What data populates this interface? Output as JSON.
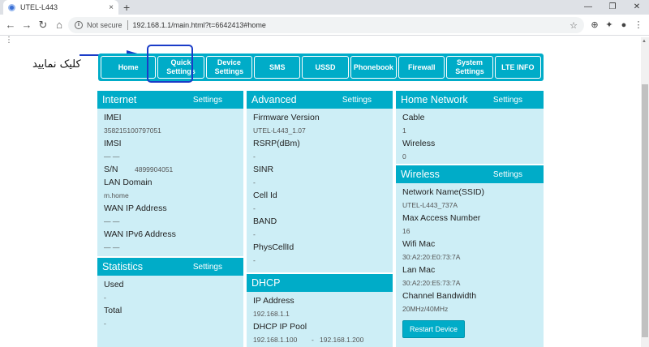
{
  "browser": {
    "tab_title": "UTEL-L443",
    "tab_close": "×",
    "new_tab": "+",
    "window_controls": [
      "—",
      "❐",
      "✕"
    ],
    "nav": [
      "←",
      "→",
      "↻",
      "⌂"
    ],
    "info_glyph": "i",
    "not_secure": "Not secure",
    "url": "192.168.1.1/main.html?t=6642413#home",
    "star": "☆",
    "extensions": [
      "⊕",
      "✦",
      "●",
      "⋮"
    ],
    "bookmarks_glyph": "⋮"
  },
  "annotation": {
    "text": "کلیک نمایید"
  },
  "nav": {
    "items": [
      {
        "label": "Home"
      },
      {
        "label": "Quick\nSettings"
      },
      {
        "label": "Device\nSettings"
      },
      {
        "label": "SMS"
      },
      {
        "label": "USSD"
      },
      {
        "label": "Phonebook"
      },
      {
        "label": "Firewall"
      },
      {
        "label": "System\nSettings"
      },
      {
        "label": "LTE INFO"
      }
    ]
  },
  "settings_label": "Settings",
  "internet": {
    "title": "Internet",
    "imei_label": "IMEI",
    "imei_value": "358215100797051",
    "imsi_label": "IMSI",
    "imsi_value": "— —",
    "sn_label": "S/N",
    "sn_value": "4899904051",
    "lan_domain_label": "LAN Domain",
    "lan_domain_value": "m.home",
    "wan_ip_label": "WAN IP Address",
    "wan_ip_value": "— —",
    "wan_ipv6_label": "WAN IPv6 Address",
    "wan_ipv6_value": "— —"
  },
  "statistics": {
    "title": "Statistics",
    "used_label": "Used",
    "used_value": "-",
    "total_label": "Total",
    "total_value": "-"
  },
  "advanced": {
    "title": "Advanced",
    "fw_label": "Firmware Version",
    "fw_value": "UTEL-L443_1.07",
    "rsrp_label": "RSRP(dBm)",
    "rsrp_value": "-",
    "sinr_label": "SINR",
    "sinr_value": "-",
    "cellid_label": "Cell Id",
    "cellid_value": "-",
    "band_label": "BAND",
    "band_value": "-",
    "phys_label": "PhysCellId",
    "phys_value": "-"
  },
  "dhcp": {
    "title": "DHCP",
    "ip_label": "IP Address",
    "ip_value": "192.168.1.1",
    "pool_label": "DHCP IP Pool",
    "pool_start": "192.168.1.100",
    "pool_dash": "-",
    "pool_end": "192.168.1.200"
  },
  "home_network": {
    "title": "Home Network",
    "cable_label": "Cable",
    "cable_value": "1",
    "wireless_label": "Wireless",
    "wireless_value": "0"
  },
  "wireless": {
    "title": "Wireless",
    "ssid_label": "Network Name(SSID)",
    "ssid_value": "UTEL-L443_737A",
    "max_label": "Max Access Number",
    "max_value": "16",
    "wifimac_label": "Wifi Mac",
    "wifimac_value": "30:A2:20:E0:73:7A",
    "lanmac_label": "Lan Mac",
    "lanmac_value": "30:A2:20:E5:73:7A",
    "bw_label": "Channel Bandwidth",
    "bw_value": "20MHz/40MHz",
    "restart_label": "Restart Device"
  }
}
